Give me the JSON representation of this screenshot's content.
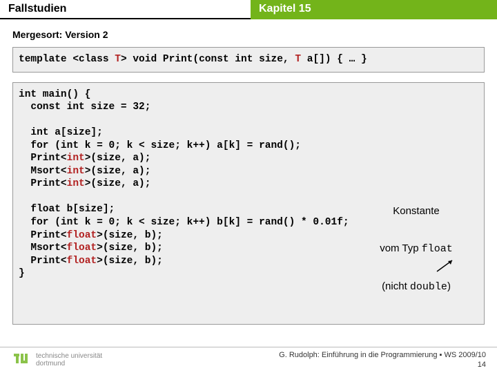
{
  "header": {
    "left": "Fallstudien",
    "right": "Kapitel 15"
  },
  "subtitle": "Mergesort: Version 2",
  "code1": {
    "t0": "template",
    "t1": " <class ",
    "t2": "T",
    "t3": "> ",
    "t4": "void",
    "t5": " Print(",
    "t6": "const int",
    "t7": " size, ",
    "t8": "T",
    "t9": " a[]) { … }"
  },
  "code2": {
    "l0a": "int",
    "l0b": " main() {",
    "l1a": "  const int",
    "l1b": " size = 32;",
    "blank": "",
    "l2a": "  int",
    "l2b": " a[size];",
    "l3a": "  for",
    "l3b": " (",
    "l3c": "int",
    "l3d": " k = 0; k < size; k++) a[k] = rand();",
    "l4a": "  Print<",
    "l4b": "int",
    "l4c": ">(size, a);",
    "l5a": "  Msort<",
    "l5b": "int",
    "l5c": ">(size, a);",
    "l6a": "  Print<",
    "l6b": "int",
    "l6c": ">(size, a);",
    "l7a": "  float",
    "l7b": " b[size];",
    "l8a": "  for",
    "l8b": " (",
    "l8c": "int",
    "l8d": " k = 0; k < size; k++) b[k] = rand() * 0.01f;",
    "l9a": "  Print<",
    "l9b": "float",
    "l9c": ">(size, b);",
    "l10a": "  Msort<",
    "l10b": "float",
    "l10c": ">(size, b);",
    "l11a": "  Print<",
    "l11b": "float",
    "l11c": ">(size, b);",
    "l12": "}"
  },
  "annotation": {
    "line1": "Konstante",
    "line2a": "vom Typ ",
    "line2b": "float",
    "line3a": "(nicht ",
    "line3b": "double",
    "line3c": ")"
  },
  "footer": {
    "uni1": "technische universität",
    "uni2": "dortmund",
    "credit": "G. Rudolph: Einführung in die Programmierung ▪ WS 2009/10",
    "page": "14"
  }
}
